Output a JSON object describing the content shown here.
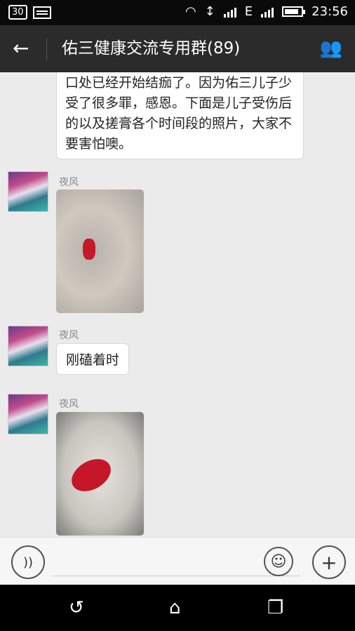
{
  "statusbar": {
    "battery_badge": "30",
    "network": "E",
    "network2": "2",
    "time": "23:56"
  },
  "header": {
    "title": "佑三健康交流专用群(89)"
  },
  "messages": [
    {
      "type": "text",
      "text": "口处已经开始结痂了。因为佑三儿子少受了很多罪，感恩。下面是儿子受伤后的以及搓膏各个时间段的照片，大家不要害怕噢。"
    },
    {
      "type": "image",
      "sender": "夜风"
    },
    {
      "type": "text",
      "sender": "夜风",
      "text": "刚磕着时"
    },
    {
      "type": "image",
      "sender": "夜风"
    }
  ],
  "icons": {
    "back": "back-arrow-icon",
    "group": "group-members-icon",
    "voice": "voice-icon",
    "emoji": "emoji-icon",
    "plus": "plus-icon"
  }
}
